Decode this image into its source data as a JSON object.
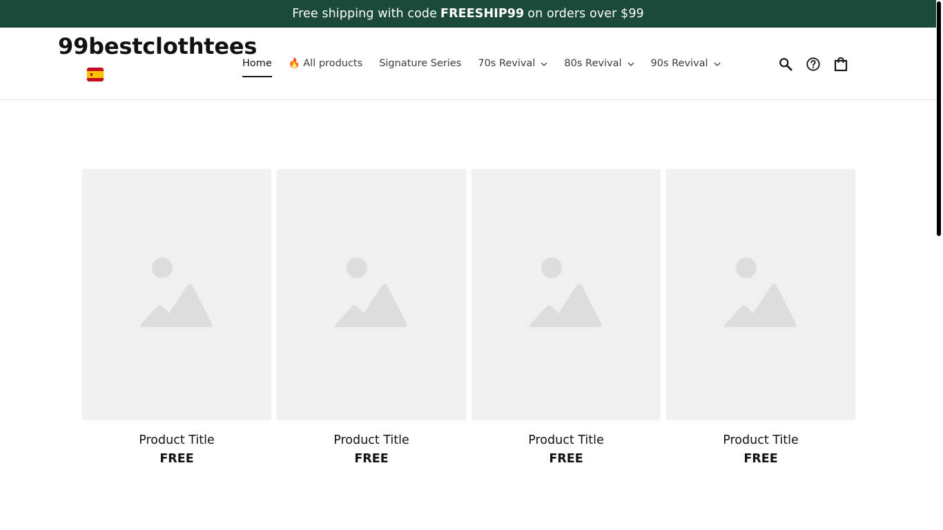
{
  "announcement": {
    "prefix": "Free shipping with code",
    "code": "FREESHIP99",
    "suffix": "on orders over $99"
  },
  "header": {
    "logo": "99bestclothtees",
    "locale_flag_icon": "spain-flag-icon"
  },
  "nav": {
    "items": [
      {
        "label": "Home",
        "active": true
      },
      {
        "label": "All products",
        "icon": "fire-icon"
      },
      {
        "label": "Signature Series"
      },
      {
        "label": "70s Revival",
        "dropdown": true
      },
      {
        "label": "80s Revival",
        "dropdown": true
      },
      {
        "label": "90s Revival",
        "dropdown": true
      }
    ]
  },
  "header_icons": [
    "search-icon",
    "help-icon",
    "cart-icon"
  ],
  "products": [
    {
      "title": "Product Title",
      "price": "FREE"
    },
    {
      "title": "Product Title",
      "price": "FREE"
    },
    {
      "title": "Product Title",
      "price": "FREE"
    },
    {
      "title": "Product Title",
      "price": "FREE"
    }
  ],
  "colors": {
    "announcement_bg": "#1b4a3b",
    "placeholder_bg": "#f0f0f0",
    "placeholder_icon": "#dddddd"
  }
}
